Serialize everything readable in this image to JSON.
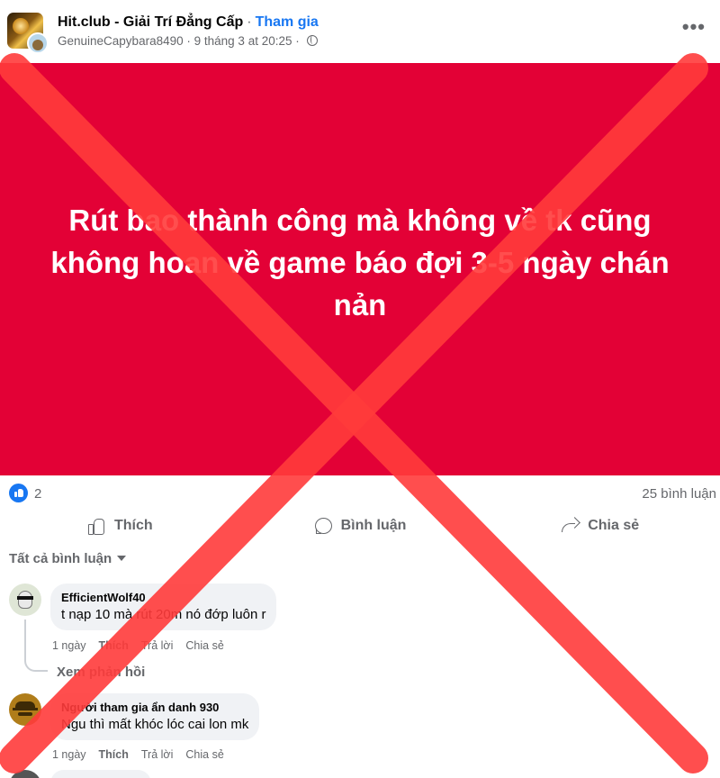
{
  "post": {
    "group_name": "Hit.club - Giải Trí Đẳng Cấp",
    "separator": "·",
    "join_label": "Tham gia",
    "author": "GenuineCapybara8490",
    "timestamp": "9 tháng 3 at 20:25",
    "meta_separator": "·",
    "more_icon": "•••",
    "banner_text": "Rút bao thành công mà không về tk cũng không hoan về game báo đợi 3-5 ngày chán nản",
    "banner_color": "#e30136"
  },
  "stats": {
    "like_count": "2",
    "comment_count": "25 bình luận"
  },
  "actions": {
    "like_label": "Thích",
    "comment_label": "Bình luận",
    "share_label": "Chia sẻ"
  },
  "filter": {
    "label": "Tất cả bình luận"
  },
  "comments": [
    {
      "name": "EfficientWolf40",
      "text": "t nạp 10 mà rút 20m nó đớp luôn r",
      "time": "1 ngày",
      "like": "Thích",
      "reply": "Trả lời",
      "share": "Chia sẻ",
      "view_replies": "Xem phản hồi"
    },
    {
      "name": "Người tham gia ẩn danh 930",
      "text": "Ngu thì mất khóc lóc cai lon mk",
      "time": "1 ngày",
      "like": "Thích",
      "reply": "Trả lời",
      "share": "Chia sẻ"
    }
  ],
  "overlay": {
    "icon": "red-x-cross",
    "color": "#ff3b3b"
  }
}
